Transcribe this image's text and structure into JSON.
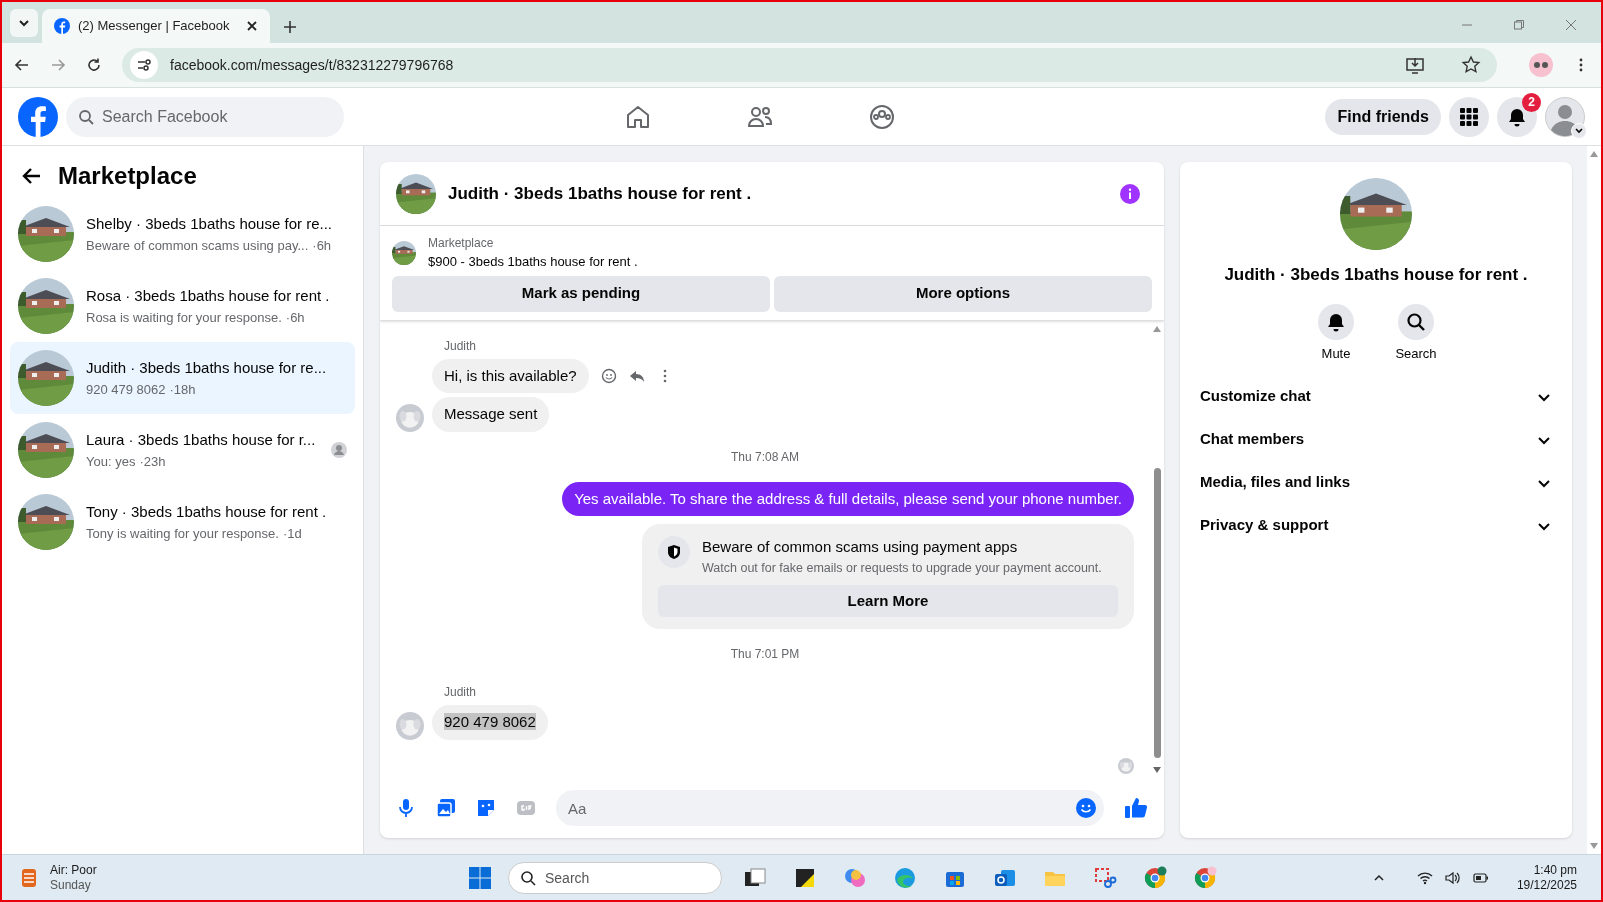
{
  "browser": {
    "tab_title": "(2) Messenger | Facebook",
    "url": "facebook.com/messages/t/832312279796768"
  },
  "header": {
    "search_placeholder": "Search Facebook",
    "find_friends": "Find friends",
    "notification_count": "2"
  },
  "sidebar": {
    "title": "Marketplace",
    "conversations": [
      {
        "title": "Shelby · 3beds 1baths house for re...",
        "preview": "Beware of common scams using pay...",
        "time": "·6h",
        "selected": false,
        "seen": false
      },
      {
        "title": "Rosa · 3beds 1baths house for rent .",
        "preview": "Rosa is waiting for your response.",
        "time": "·6h",
        "selected": false,
        "seen": false
      },
      {
        "title": "Judith · 3beds 1baths house for re...",
        "preview": "920 479 8062",
        "time": "·18h",
        "selected": true,
        "seen": false
      },
      {
        "title": "Laura · 3beds 1baths house for r...",
        "preview": "You: yes",
        "time": "·23h",
        "selected": false,
        "seen": true
      },
      {
        "title": "Tony · 3beds 1baths house for rent .",
        "preview": "Tony is waiting for your response.",
        "time": "·1d",
        "selected": false,
        "seen": false
      }
    ]
  },
  "chat": {
    "title": "Judith · 3beds 1baths house for rent .",
    "listing": {
      "label": "Marketplace",
      "title": "$900 - 3beds 1baths house for rent ."
    },
    "actions": [
      "Mark as pending",
      "More options"
    ],
    "messages": [
      {
        "kind": "received",
        "sender": "Judith",
        "bubbles": [
          {
            "text": "Hi, is this available?",
            "text_selected": false
          },
          {
            "text": "Message sent",
            "text_selected": false
          }
        ]
      },
      {
        "kind": "timestamp",
        "text": "Thu 7:08 AM"
      },
      {
        "kind": "sent",
        "text": "Yes available. To share the address & full details, please send your phone number."
      },
      {
        "kind": "notice",
        "title": "Beware of common scams using payment apps",
        "body": "Watch out for fake emails or requests to upgrade your payment account.",
        "button": "Learn More"
      },
      {
        "kind": "timestamp",
        "text": "Thu 7:01 PM"
      },
      {
        "kind": "received",
        "sender": "Judith",
        "bubbles": [
          {
            "text": "920 479 8062",
            "text_selected": true
          }
        ]
      }
    ],
    "composer_placeholder": "Aa"
  },
  "details": {
    "title": "Judith · 3beds 1baths house for rent .",
    "actions": [
      {
        "kind": "mute",
        "label": "Mute"
      },
      {
        "kind": "search",
        "label": "Search"
      }
    ],
    "sections": [
      "Customize chat",
      "Chat members",
      "Media, files and links",
      "Privacy & support"
    ]
  },
  "taskbar": {
    "weather_title": "Air: Poor",
    "weather_subtitle": "Sunday",
    "search_placeholder": "Search",
    "time": "1:40 pm",
    "date": "19/12/2025"
  }
}
